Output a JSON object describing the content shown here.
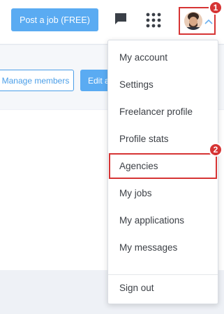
{
  "header": {
    "post_job_label": "Post a job (FREE)",
    "icons": [
      "chat-icon",
      "apps-grid-icon",
      "chevron-up-icon"
    ]
  },
  "toolbar": {
    "manage_members_label": "Manage members",
    "edit_label": "Edit a"
  },
  "account_menu": {
    "items": [
      {
        "label": "My account"
      },
      {
        "label": "Settings"
      },
      {
        "label": "Freelancer profile"
      },
      {
        "label": "Profile stats"
      },
      {
        "label": "Agencies"
      },
      {
        "label": "My jobs"
      },
      {
        "label": "My applications"
      },
      {
        "label": "My messages"
      },
      {
        "label": "Sign out"
      }
    ]
  },
  "annotations": {
    "step1": "1",
    "step2": "2"
  },
  "colors": {
    "accent": "#5aabf2",
    "annotation": "#d63434",
    "text": "#3b3f45"
  }
}
